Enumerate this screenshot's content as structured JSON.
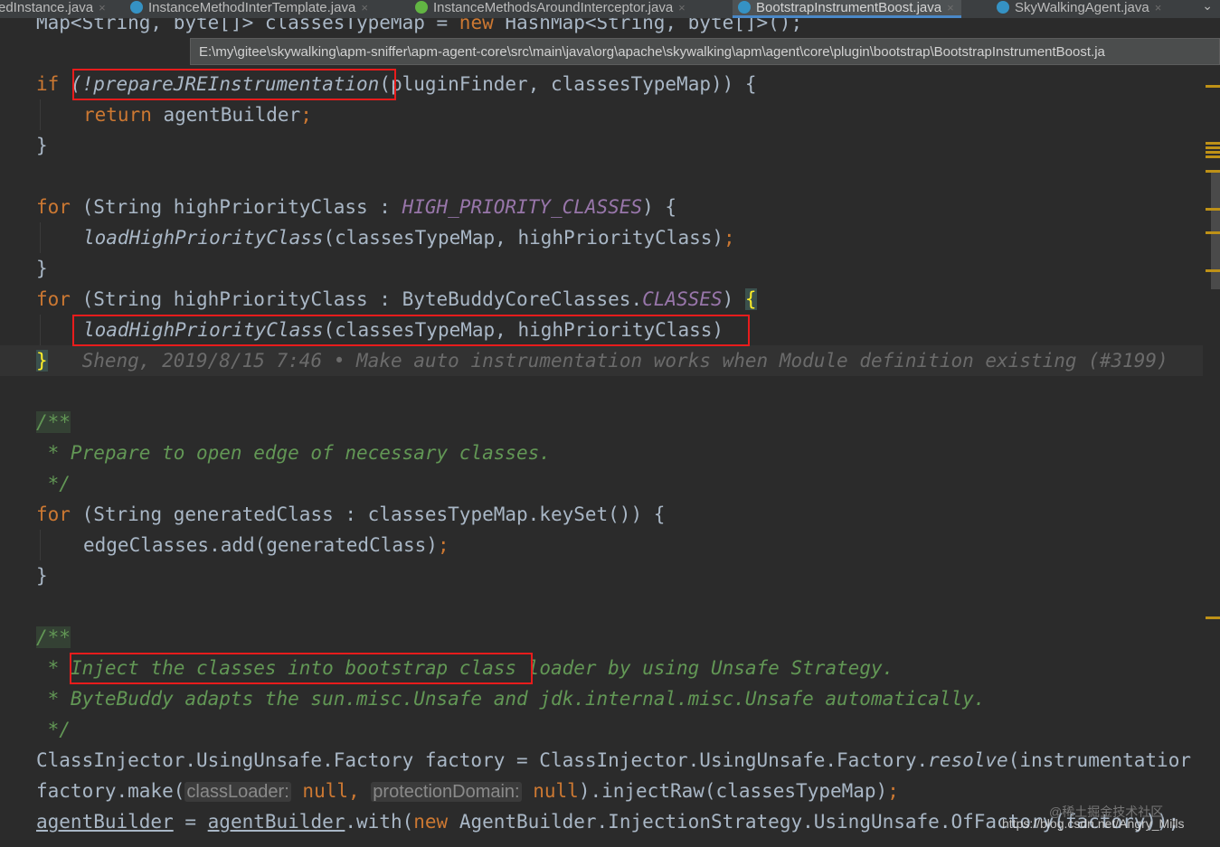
{
  "tabs": [
    {
      "label": "edInstance.java",
      "active": false
    },
    {
      "label": "InstanceMethodInterTemplate.java",
      "active": false
    },
    {
      "label": "InstanceMethodsAroundInterceptor.java",
      "active": false
    },
    {
      "label": "BootstrapInstrumentBoost.java",
      "active": true
    },
    {
      "label": "SkyWalkingAgent.java",
      "active": false
    }
  ],
  "tab_close": "×",
  "tab_menu": "⌄",
  "tooltip_path": "E:\\my\\gitee\\skywalking\\apm-sniffer\\apm-agent-core\\src\\main\\java\\org\\apache\\skywalking\\apm\\agent\\core\\plugin\\bootstrap\\BootstrapInstrumentBoost.ja",
  "code": {
    "l0": {
      "a": "Map<String, byte[]> classesTypeMap = ",
      "kw": "new",
      "b": " HashMap<String, byte[]>();"
    },
    "l1": {
      "kw": "if",
      "fn": "(!prepareJREInstrumentation",
      "b": "(pluginFinder, classesTypeMap)) {"
    },
    "l2": {
      "kw": "return",
      "b": " agentBuilder",
      "semi": ";"
    },
    "l3": "}",
    "l4": {
      "kw": "for",
      "a": " (String highPriorityClass : ",
      "const": "HIGH_PRIORITY_CLASSES",
      "b": ") {"
    },
    "l5": {
      "fn": "loadHighPriorityClass",
      "a": "(classesTypeMap, highPriorityClass)",
      "semi": ";"
    },
    "l6": "}",
    "l7": {
      "kw": "for",
      "a": " (String highPriorityClass : ByteBuddyCoreClasses.",
      "const": "CLASSES",
      "b": ") ",
      "brace": "{"
    },
    "l8": {
      "fn": "loadHighPriorityClass",
      "a": "(classesTypeMap, highPriorityClass)"
    },
    "l9": {
      "brace": "}",
      "blame": "Sheng, 2019/8/15 7:46 • Make auto instrumentation works when Module definition existing (#3199)"
    },
    "l10": "/**",
    "l11": " * Prepare to open edge of necessary classes.",
    "l12": " */",
    "l13": {
      "kw": "for",
      "a": " (String generatedClass : classesTypeMap.keySet()) {"
    },
    "l14": {
      "a": "edgeClasses.add(generatedClass)",
      "semi": ";"
    },
    "l15": "}",
    "l16": "/**",
    "l17": {
      "star": " * ",
      "a": "Inject the classes into bootstrap class",
      "b": " loader by using Unsafe Strategy."
    },
    "l18": " * ByteBuddy adapts the sun.misc.Unsafe and jdk.internal.misc.Unsafe automatically.",
    "l19": " */",
    "l20": {
      "a": "ClassInjector.UsingUnsafe.Factory factory = ClassInjector.UsingUnsafe.Factory.",
      "fn": "resolve",
      "b": "(instrumentatior"
    },
    "l21": {
      "a": "factory.make(",
      "hint1": "classLoader:",
      "kw1": " null",
      "c1": ", ",
      "hint2": "protectionDomain:",
      "kw2": " null",
      "b": ").injectRaw(classesTypeMap)",
      "semi": ";"
    },
    "l22": {
      "u1": "agentBuilder",
      "a": " = ",
      "u2": "agentBuilder",
      "b": ".with(",
      "kw": "new",
      "c": " AgentBuilder.InjectionStrategy.UsingUnsafe.OfFactory(factory));"
    }
  },
  "watermark": "https://blog.csdn.net/Angry_Mills",
  "watermark_cn": "@稀土掘金技术社区",
  "colors": {
    "keyword": "#cc7832",
    "text": "#a9b7c6",
    "constant": "#9876aa",
    "doc": "#629755",
    "highlight_box": "#e81c1c"
  }
}
